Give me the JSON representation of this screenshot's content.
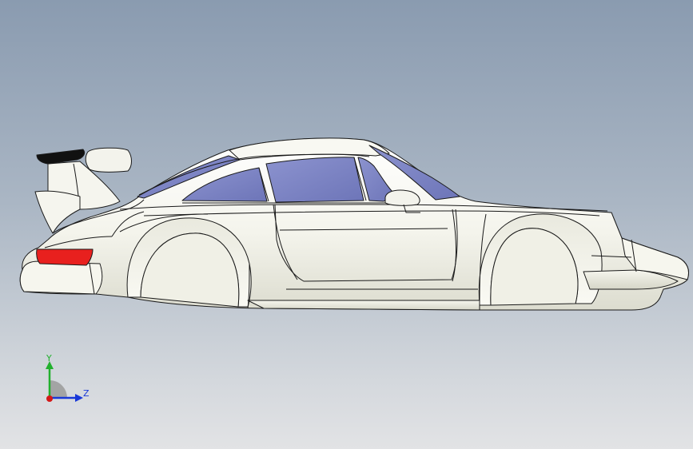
{
  "viewport": {
    "background_top": "#8a9bb0",
    "background_bottom": "#e2e3e5"
  },
  "model": {
    "body_color": "#f3f3ec",
    "edge_color": "#1a1a1a",
    "glass_color": "#7e86c4",
    "taillight_color": "#e8201e",
    "spoiler_color": "#111111"
  },
  "triad": {
    "y_label": "Y",
    "z_label": "Z",
    "y_color": "#22b02e",
    "z_color": "#1838d8",
    "x_color": "#d41818"
  }
}
